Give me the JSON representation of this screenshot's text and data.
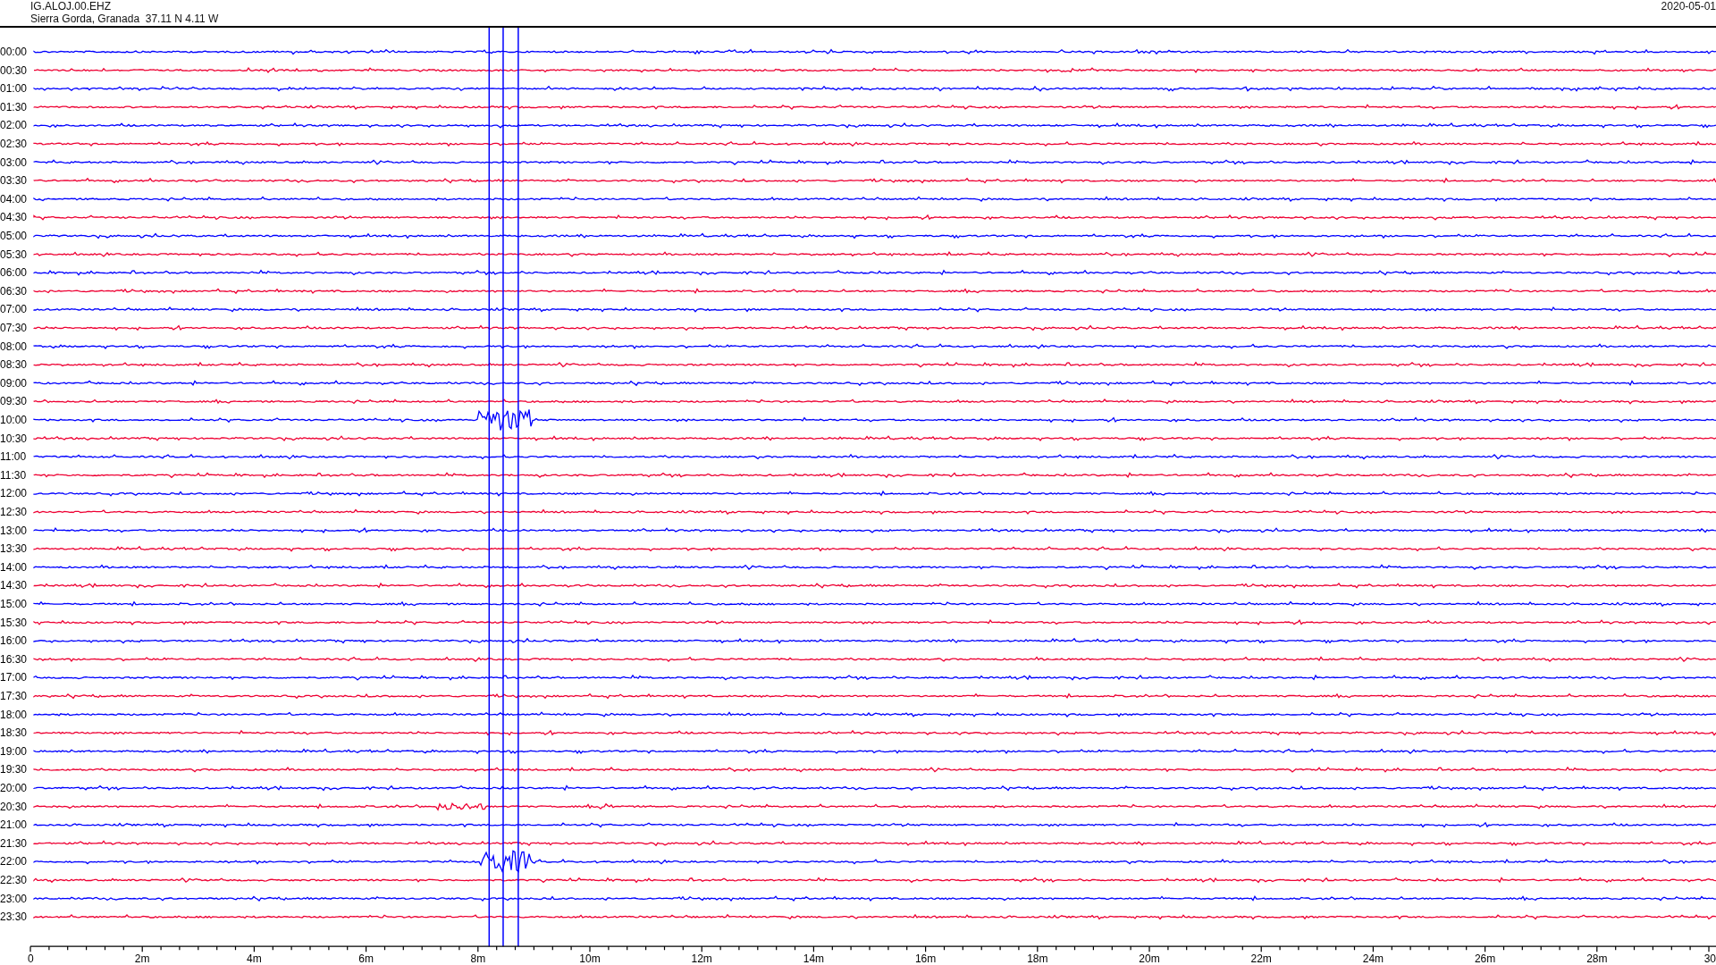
{
  "header": {
    "channel": "IG.ALOJ.00.EHZ",
    "location": "Sierra Gorda, Granada  37.11 N 4.11 W",
    "date": "2020-05-01"
  },
  "rows": [
    {
      "time": "00:00",
      "color": "#0000ff"
    },
    {
      "time": "00:30",
      "color": "#ee0033"
    },
    {
      "time": "01:00",
      "color": "#0000ff"
    },
    {
      "time": "01:30",
      "color": "#ee0033"
    },
    {
      "time": "02:00",
      "color": "#0000ff"
    },
    {
      "time": "02:30",
      "color": "#ee0033"
    },
    {
      "time": "03:00",
      "color": "#0000ff"
    },
    {
      "time": "03:30",
      "color": "#ee0033"
    },
    {
      "time": "04:00",
      "color": "#0000ff"
    },
    {
      "time": "04:30",
      "color": "#ee0033"
    },
    {
      "time": "05:00",
      "color": "#0000ff"
    },
    {
      "time": "05:30",
      "color": "#ee0033"
    },
    {
      "time": "06:00",
      "color": "#0000ff"
    },
    {
      "time": "06:30",
      "color": "#ee0033"
    },
    {
      "time": "07:00",
      "color": "#0000ff"
    },
    {
      "time": "07:30",
      "color": "#ee0033"
    },
    {
      "time": "08:00",
      "color": "#0000ff"
    },
    {
      "time": "08:30",
      "color": "#ee0033"
    },
    {
      "time": "09:00",
      "color": "#0000ff"
    },
    {
      "time": "09:30",
      "color": "#ee0033"
    },
    {
      "time": "10:00",
      "color": "#0000ff"
    },
    {
      "time": "10:30",
      "color": "#ee0033"
    },
    {
      "time": "11:00",
      "color": "#0000ff"
    },
    {
      "time": "11:30",
      "color": "#ee0033"
    },
    {
      "time": "12:00",
      "color": "#0000ff"
    },
    {
      "time": "12:30",
      "color": "#ee0033"
    },
    {
      "time": "13:00",
      "color": "#0000ff"
    },
    {
      "time": "13:30",
      "color": "#ee0033"
    },
    {
      "time": "14:00",
      "color": "#0000ff"
    },
    {
      "time": "14:30",
      "color": "#ee0033"
    },
    {
      "time": "15:00",
      "color": "#0000ff"
    },
    {
      "time": "15:30",
      "color": "#ee0033"
    },
    {
      "time": "16:00",
      "color": "#0000ff"
    },
    {
      "time": "16:30",
      "color": "#ee0033"
    },
    {
      "time": "17:00",
      "color": "#0000ff"
    },
    {
      "time": "17:30",
      "color": "#ee0033"
    },
    {
      "time": "18:00",
      "color": "#0000ff"
    },
    {
      "time": "18:30",
      "color": "#ee0033"
    },
    {
      "time": "19:00",
      "color": "#0000ff"
    },
    {
      "time": "19:30",
      "color": "#ee0033"
    },
    {
      "time": "20:00",
      "color": "#0000ff"
    },
    {
      "time": "20:30",
      "color": "#ee0033"
    },
    {
      "time": "21:00",
      "color": "#0000ff"
    },
    {
      "time": "21:30",
      "color": "#ee0033"
    },
    {
      "time": "22:00",
      "color": "#0000ff"
    },
    {
      "time": "22:30",
      "color": "#ee0033"
    },
    {
      "time": "23:00",
      "color": "#0000ff"
    },
    {
      "time": "23:30",
      "color": "#ee0033"
    }
  ],
  "x_axis": {
    "labels": [
      "0",
      "2m",
      "4m",
      "6m",
      "8m",
      "10m",
      "12m",
      "14m",
      "16m",
      "18m",
      "20m",
      "22m",
      "24m",
      "26m",
      "28m",
      "30"
    ]
  }
}
